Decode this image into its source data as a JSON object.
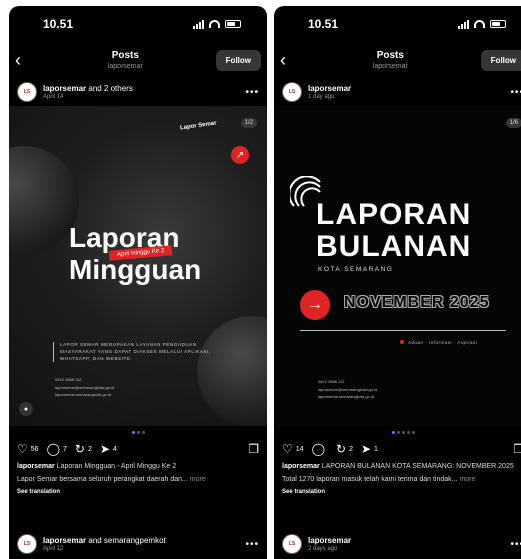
{
  "left": {
    "status": {
      "time": "10.51"
    },
    "nav": {
      "title": "Posts",
      "subtitle": "laporsemar",
      "follow": "Follow"
    },
    "post": {
      "author": "laporsemar",
      "coauthors": " and 2 others",
      "time": "April 14",
      "counter": "1/2",
      "brand": "Lapor Semar",
      "title1": "Laporan",
      "title2": "Mingguan",
      "tag": "April minggu Ke 2",
      "description": "Lapor Semar merupakan layanan pengaduan masyarakat yang dapat diakses melalui aplikasi, WhatsApp, dan website.",
      "contacts": [
        "0812 2888 112",
        "laporsemar@semarangkota.go.id",
        "laporsemar.semarangkota.go.id"
      ],
      "likes": "56",
      "comments": "7",
      "reposts": "2",
      "shares": "4",
      "caption_user": "laporsemar",
      "caption_text": " Laporan Mingguan - April Minggu Ke 2",
      "caption_body": "Lapor Semar bersama seluruh perangkat daerah dan...",
      "more": " more",
      "see_translation": "See translation"
    },
    "next": {
      "author": "laporsemar",
      "coauthors": " and semarangpemkot",
      "time": "April 12"
    }
  },
  "right": {
    "status": {
      "time": "10.51"
    },
    "nav": {
      "title": "Posts",
      "subtitle": "laporsemar",
      "follow": "Follow"
    },
    "post": {
      "author": "laporsemar",
      "time": "1 day ago",
      "counter": "1/6",
      "line1": "LAPORAN",
      "line2": "BULANAN",
      "city": "KOTA SEMARANG",
      "month": "NOVEMBER 2025",
      "tagline": "Aduan · Informasi · Aspirasi",
      "contacts": [
        "0812 2888 112",
        "laporsemar@semarangkota.go.id",
        "laporsemar.semarangkota.go.id"
      ],
      "likes": "14",
      "comments": "",
      "reposts": "2",
      "shares": "1",
      "caption_user": "laporsemar",
      "caption_text": " LAPORAN BULANAN KOTA SEMARANG: NOVEMBER 2025",
      "caption_body": "Total 1270 laporan masuk telah kami terima dan tindak...",
      "more": " more",
      "see_translation": "See translation"
    },
    "next": {
      "author": "laporsemar",
      "time": "2 days ago"
    }
  },
  "colors": {
    "accent_red": "#e02424",
    "bg": "#000000",
    "active_dot": "#4a8cf7"
  }
}
